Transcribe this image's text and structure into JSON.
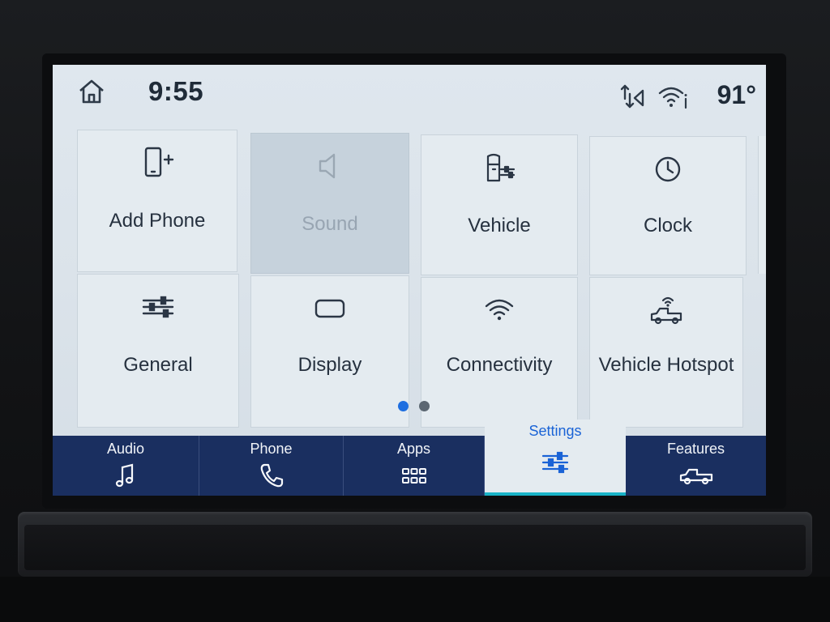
{
  "status_bar": {
    "time": "9:55",
    "temperature": "91°",
    "icons": [
      "home-icon",
      "sync-icon",
      "wifi-icon"
    ]
  },
  "settings_tiles": [
    {
      "label": "Add Phone",
      "icon": "add-phone-icon",
      "enabled": true
    },
    {
      "label": "Sound",
      "icon": "speaker-icon",
      "enabled": false
    },
    {
      "label": "Vehicle",
      "icon": "vehicle-settings-icon",
      "enabled": true
    },
    {
      "label": "Clock",
      "icon": "clock-icon",
      "enabled": true
    },
    {
      "label": "General",
      "icon": "sliders-icon",
      "enabled": true
    },
    {
      "label": "Display",
      "icon": "display-icon",
      "enabled": true
    },
    {
      "label": "Connectivity",
      "icon": "wifi-icon",
      "enabled": true
    },
    {
      "label": "Vehicle Hotspot",
      "icon": "hotspot-icon",
      "enabled": true
    }
  ],
  "pagination": {
    "current_page": 1,
    "total_pages": 2
  },
  "nav": [
    {
      "label": "Audio",
      "icon": "music-note-icon",
      "active": false
    },
    {
      "label": "Phone",
      "icon": "phone-icon",
      "active": false
    },
    {
      "label": "Apps",
      "icon": "apps-grid-icon",
      "active": false
    },
    {
      "label": "Settings",
      "icon": "settings-sliders-icon",
      "active": true
    },
    {
      "label": "Features",
      "icon": "truck-icon",
      "active": false
    }
  ],
  "colors": {
    "nav_background": "#1a2f60",
    "active_accent": "#1a63d6",
    "active_underline": "#19b3c7",
    "page_dot_active": "#1d6ee0"
  }
}
